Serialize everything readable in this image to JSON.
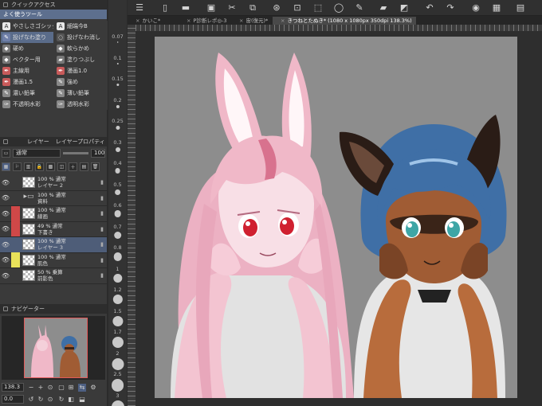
{
  "quick_access": {
    "title": "クイックアクセス",
    "subtitle": "よく使うツール",
    "items": [
      {
        "label": "やさしさゴシック",
        "icon": "text-icon",
        "color": "#e8e8e8"
      },
      {
        "label": "細端今B",
        "icon": "text-icon",
        "color": "#e8e8e8"
      },
      {
        "label": "投げなわ塗り",
        "icon": "lasso-fill-icon",
        "color": "#6f7fa8",
        "selected": true
      },
      {
        "label": "投げなわ消し",
        "icon": "lasso-erase-icon",
        "color": "#555555"
      },
      {
        "label": "硬め",
        "icon": "eraser-icon",
        "color": "#777777"
      },
      {
        "label": "軟らかめ",
        "icon": "eraser-icon",
        "color": "#777777"
      },
      {
        "label": "ベクター用",
        "icon": "eraser-icon",
        "color": "#777777"
      },
      {
        "label": "塗りつぶし",
        "icon": "fill-icon",
        "color": "#777777"
      },
      {
        "label": "主線用",
        "icon": "pen-icon",
        "color": "#c85a5a"
      },
      {
        "label": "漫画1.0",
        "icon": "pen-icon",
        "color": "#c85a5a"
      },
      {
        "label": "漫画1.5",
        "icon": "pen-icon",
        "color": "#c85a5a"
      },
      {
        "label": "強め",
        "icon": "pencil-icon",
        "color": "#888888"
      },
      {
        "label": "濃い鉛筆",
        "icon": "pencil-icon",
        "color": "#888888"
      },
      {
        "label": "薄い鉛筆",
        "icon": "pencil-icon",
        "color": "#888888"
      },
      {
        "label": "不透明水彩",
        "icon": "brush-icon",
        "color": "#888888"
      },
      {
        "label": "透明水彩",
        "icon": "brush-icon",
        "color": "#888888"
      }
    ]
  },
  "layer_panel": {
    "tab_layer": "レイヤー",
    "tab_property": "レイヤープロパティ",
    "blend_mode": "通常",
    "opacity": "100",
    "layers": [
      {
        "pct": "100 % 通常",
        "name": "レイヤー 2",
        "tag": "",
        "kind": "raster"
      },
      {
        "pct": "100 % 通常",
        "name": "資料",
        "tag": "",
        "kind": "folder"
      },
      {
        "pct": "100 % 通常",
        "name": "線画",
        "tag": "#d04848",
        "kind": "raster"
      },
      {
        "pct": "49 % 通常",
        "name": "下書き",
        "tag": "#d04848",
        "kind": "raster"
      },
      {
        "pct": "100 % 通常",
        "name": "レイヤー 3",
        "tag": "",
        "kind": "raster",
        "selected": true
      },
      {
        "pct": "100 % 通常",
        "name": "肌色",
        "tag": "#e8e25a",
        "kind": "raster"
      },
      {
        "pct": "50 % 乗算",
        "name": "前影色",
        "tag": "",
        "kind": "raster"
      }
    ]
  },
  "navigator": {
    "title": "ナビゲーター",
    "zoom": "138.3",
    "rotation": "0.0"
  },
  "brush_sizes": [
    "0.07",
    "0.1",
    "0.15",
    "0.2",
    "0.25",
    "0.3",
    "0.4",
    "0.5",
    "0.6",
    "0.7",
    "0.8",
    "1",
    "1.2",
    "1.5",
    "1.7",
    "2",
    "2.5",
    "3"
  ],
  "tabs": [
    {
      "label": "かいこ*"
    },
    {
      "label": "P診断レポ◎-3"
    },
    {
      "label": "宙(復元)*"
    },
    {
      "label": "きつねとたぬき* (1080 x 1080px 350dpi 138.3%)",
      "active": true
    }
  ],
  "colors": {
    "bunny_hair": "#f0b8c8",
    "bunny_shadow": "#d890a8",
    "bunny_eye": "#d02030",
    "cat_hair": "#3f6fa6",
    "cat_skin": "#a05c34",
    "cat_mask": "#3a2418",
    "cat_eye": "#3ea6a6",
    "shirt": "#e6e6e6",
    "canvas_bg": "#8d8d8d"
  }
}
